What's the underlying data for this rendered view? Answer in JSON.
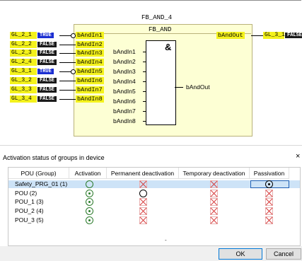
{
  "fbd": {
    "instance_name": "FB_AND_4",
    "type_name": "FB_AND",
    "inputs": [
      {
        "var": "GL_2_1",
        "value": "TRUE",
        "pin": "bAndIn1",
        "negated": true
      },
      {
        "var": "GL_2_2",
        "value": "FALSE",
        "pin": "bAndIn2",
        "negated": false
      },
      {
        "var": "GL_2_3",
        "value": "FALSE",
        "pin": "bAndIn3",
        "negated": false
      },
      {
        "var": "GL_2_4",
        "value": "FALSE",
        "pin": "bAndIn4",
        "negated": false
      },
      {
        "var": "GL_3_1",
        "value": "TRUE",
        "pin": "bAndIn5",
        "negated": true
      },
      {
        "var": "GL_3_2",
        "value": "FALSE",
        "pin": "bAndIn6",
        "negated": false
      },
      {
        "var": "GL_3_3",
        "value": "FALSE",
        "pin": "bAndIn7",
        "negated": false
      },
      {
        "var": "GL_3_4",
        "value": "FALSE",
        "pin": "bAndIn8",
        "negated": false
      }
    ],
    "output": {
      "pin": "bAndOut",
      "var": "GL_3_1",
      "value": "FALSE"
    },
    "and_block": {
      "symbol": "&",
      "inputs": [
        "bAndIn1",
        "bAndIn2",
        "bAndIn3",
        "bAndIn4",
        "bAndIn5",
        "bAndIn6",
        "bAndIn7",
        "bAndIn8"
      ],
      "output": "bAndOut"
    }
  },
  "dialog": {
    "title": "Activation status of groups in device",
    "close_label": "×",
    "columns": [
      "POU (Group)",
      "Activation",
      "Permanent deactivation",
      "Temporary deactivation",
      "Passivation"
    ],
    "rows": [
      {
        "name": "Safety_PRG_01 (1)",
        "activation": "radio-off",
        "permanent": "cross",
        "temporary": "cross",
        "passivation": "radio-black-on"
      },
      {
        "name": "POU (2)",
        "activation": "radio-on",
        "permanent": "radio-black",
        "temporary": "cross",
        "passivation": "cross"
      },
      {
        "name": "POU_1 (3)",
        "activation": "radio-on",
        "permanent": "cross",
        "temporary": "cross",
        "passivation": "cross"
      },
      {
        "name": "POU_2 (4)",
        "activation": "radio-on",
        "permanent": "cross",
        "temporary": "cross",
        "passivation": "cross"
      },
      {
        "name": "POU_3 (5)",
        "activation": "radio-on",
        "permanent": "cross",
        "temporary": "cross",
        "passivation": "cross"
      }
    ],
    "selected_row": 0,
    "dot": "-",
    "ok_label": "OK",
    "cancel_label": "Cancel"
  },
  "colors": {
    "variable_highlight": "#f4f21c",
    "value_true": "#1c2fd2",
    "value_false": "#1b1b1b",
    "block_fill": "#fdffd4",
    "selection": "#cde3f7"
  }
}
